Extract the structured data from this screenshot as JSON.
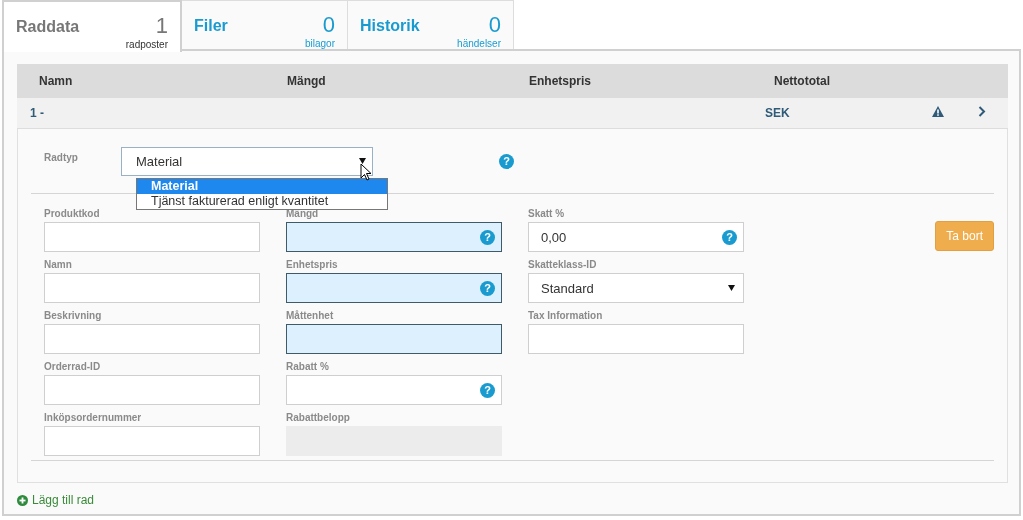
{
  "tabs": [
    {
      "label": "Raddata",
      "count": "1",
      "unit": "radposter",
      "selected": true
    },
    {
      "label": "Filer",
      "count": "0",
      "unit": "bilagor",
      "selected": false
    },
    {
      "label": "Historik",
      "count": "0",
      "unit": "händelser",
      "selected": false
    }
  ],
  "table": {
    "columns": [
      "Namn",
      "Mängd",
      "Enhetspris",
      "Nettototal"
    ],
    "rows": [
      {
        "name": "1 -",
        "currency": "SEK",
        "warning": true,
        "expanded": true
      }
    ]
  },
  "help_symbol": "?",
  "row_type": {
    "label": "Radtyp",
    "value": "Material",
    "open": true,
    "help": true,
    "options": [
      {
        "label": "Material",
        "selected": true
      },
      {
        "label": "Tjänst fakturerad enligt kvantitet",
        "selected": false
      }
    ]
  },
  "field_columns": [
    [
      {
        "label": "Produktkod",
        "kind": "text",
        "required": false,
        "help": false
      },
      {
        "label": "Namn",
        "kind": "text",
        "required": false,
        "help": false
      },
      {
        "label": "Beskrivning",
        "kind": "text",
        "required": false,
        "help": false
      },
      {
        "label": "Orderrad-ID",
        "kind": "text",
        "required": false,
        "help": false
      },
      {
        "label": "Inköpsordernummer",
        "kind": "text",
        "required": false,
        "help": false
      }
    ],
    [
      {
        "label": "Mängd",
        "kind": "text",
        "required": true,
        "help": true
      },
      {
        "label": "Enhetspris",
        "kind": "text",
        "required": true,
        "help": true
      },
      {
        "label": "Måttenhet",
        "kind": "text",
        "required": true,
        "help": false
      },
      {
        "label": "Rabatt %",
        "kind": "text",
        "required": false,
        "help": true
      },
      {
        "label": "Rabattbelopp",
        "kind": "disabled"
      }
    ],
    [
      {
        "label": "Skatt %",
        "kind": "text",
        "value": "0,00",
        "required": false,
        "help": true
      },
      {
        "label": "Skatteklass-ID",
        "kind": "select",
        "value": "Standard"
      },
      {
        "label": "Tax Information",
        "kind": "text",
        "required": false,
        "help": false
      }
    ]
  ],
  "delete_button": "Ta bort",
  "add_row": "Lägg till rad"
}
